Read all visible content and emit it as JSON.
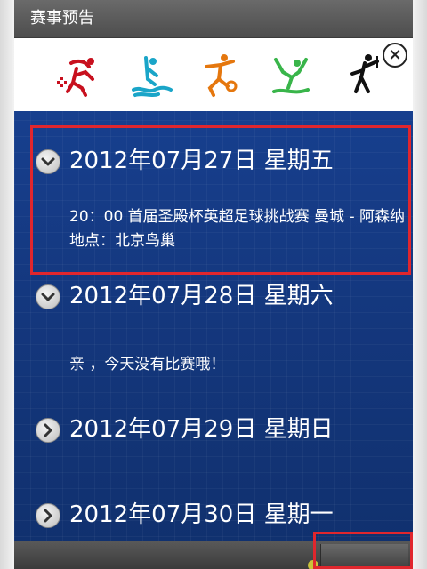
{
  "app": {
    "title": "赛事预告"
  },
  "banner": {
    "icons": [
      "sport-pictogram-1-icon",
      "sport-pictogram-2-icon",
      "sport-pictogram-3-icon",
      "sport-pictogram-4-icon",
      "sport-pictogram-5-icon"
    ],
    "colors": [
      "#c8101e",
      "#1aa5c8",
      "#e5770e",
      "#39b54a",
      "#111111"
    ]
  },
  "close_icon": "close-icon",
  "schedule": {
    "days": [
      {
        "label": "2012年07月27日 星期五",
        "expanded": true,
        "events": [
          "20：00 首届圣殿杯英超足球挑战赛 曼城 - 阿森纳 地点：北京鸟巢"
        ]
      },
      {
        "label": "2012年07月28日 星期六",
        "expanded": true,
        "events": [
          "亲 ，今天没有比赛哦！"
        ]
      },
      {
        "label": "2012年07月29日 星期日",
        "expanded": false,
        "events": []
      },
      {
        "label": "2012年07月30日 星期一",
        "expanded": false,
        "events": []
      }
    ]
  },
  "highlight_color": "#e0262d"
}
